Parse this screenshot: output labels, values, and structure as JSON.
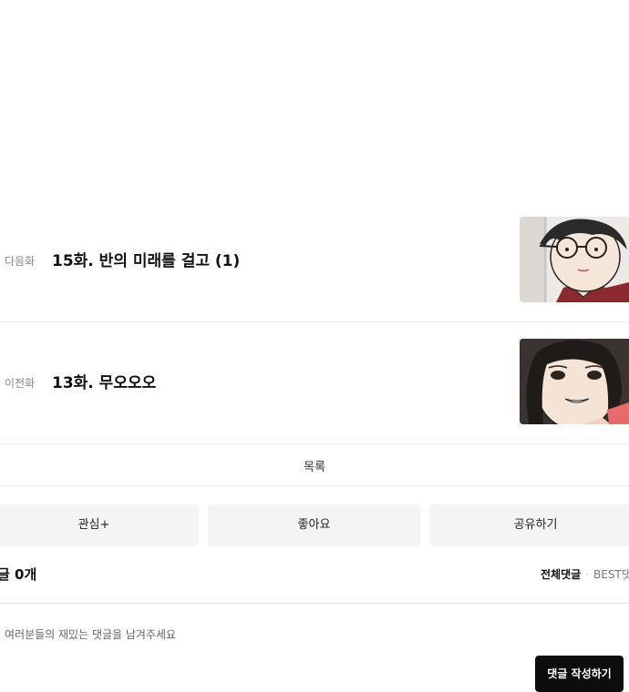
{
  "episodes": {
    "next": {
      "kind": "다음화",
      "title": "15화. 반의 미래를 걸고 (1)"
    },
    "prev": {
      "kind": "이전화",
      "title": "13화. 무오오오"
    }
  },
  "navigation": {
    "list_label": "목록"
  },
  "actions": {
    "favorite": "관심+",
    "like": "좋아요",
    "share": "공유하기"
  },
  "comments": {
    "count_label": "글 0개",
    "tab_all": "전체댓글",
    "tab_separator": "·",
    "tab_best": "BEST댓",
    "placeholder": "여러분들의 재밌는 댓글을 남겨주세요",
    "write_button": "댓글 작성하기"
  }
}
